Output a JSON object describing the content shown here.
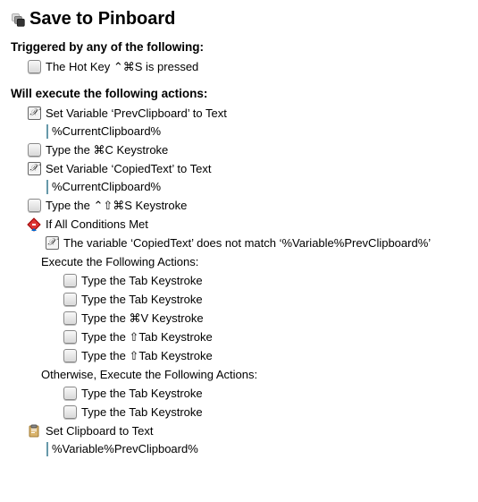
{
  "title": "Save to Pinboard",
  "triggers": {
    "header": "Triggered by any of the following:",
    "items": [
      {
        "label": "The Hot Key ⌃⌘S is pressed"
      }
    ]
  },
  "actions": {
    "header": "Will execute the following actions:",
    "a1": {
      "label": "Set Variable ‘PrevClipboard’ to Text",
      "token": "%CurrentClipboard%"
    },
    "a2": {
      "label": "Type the ⌘C Keystroke"
    },
    "a3": {
      "label": "Set Variable ‘CopiedText’ to Text",
      "token": "%CurrentClipboard%"
    },
    "a4": {
      "label": "Type the ⌃⇧⌘S Keystroke"
    },
    "if": {
      "label": "If All Conditions Met",
      "condition": "The variable ‘CopiedText’ does not match ‘%Variable%PrevClipboard%’",
      "then_label": "Execute the Following Actions:",
      "then": [
        "Type the Tab Keystroke",
        "Type the Tab Keystroke",
        "Type the ⌘V Keystroke",
        "Type the ⇧Tab Keystroke",
        "Type the ⇧Tab Keystroke"
      ],
      "else_label": "Otherwise, Execute the Following Actions:",
      "else": [
        "Type the Tab Keystroke",
        "Type the Tab Keystroke"
      ]
    },
    "a_last": {
      "label": "Set Clipboard to Text",
      "token": "%Variable%PrevClipboard%"
    }
  }
}
